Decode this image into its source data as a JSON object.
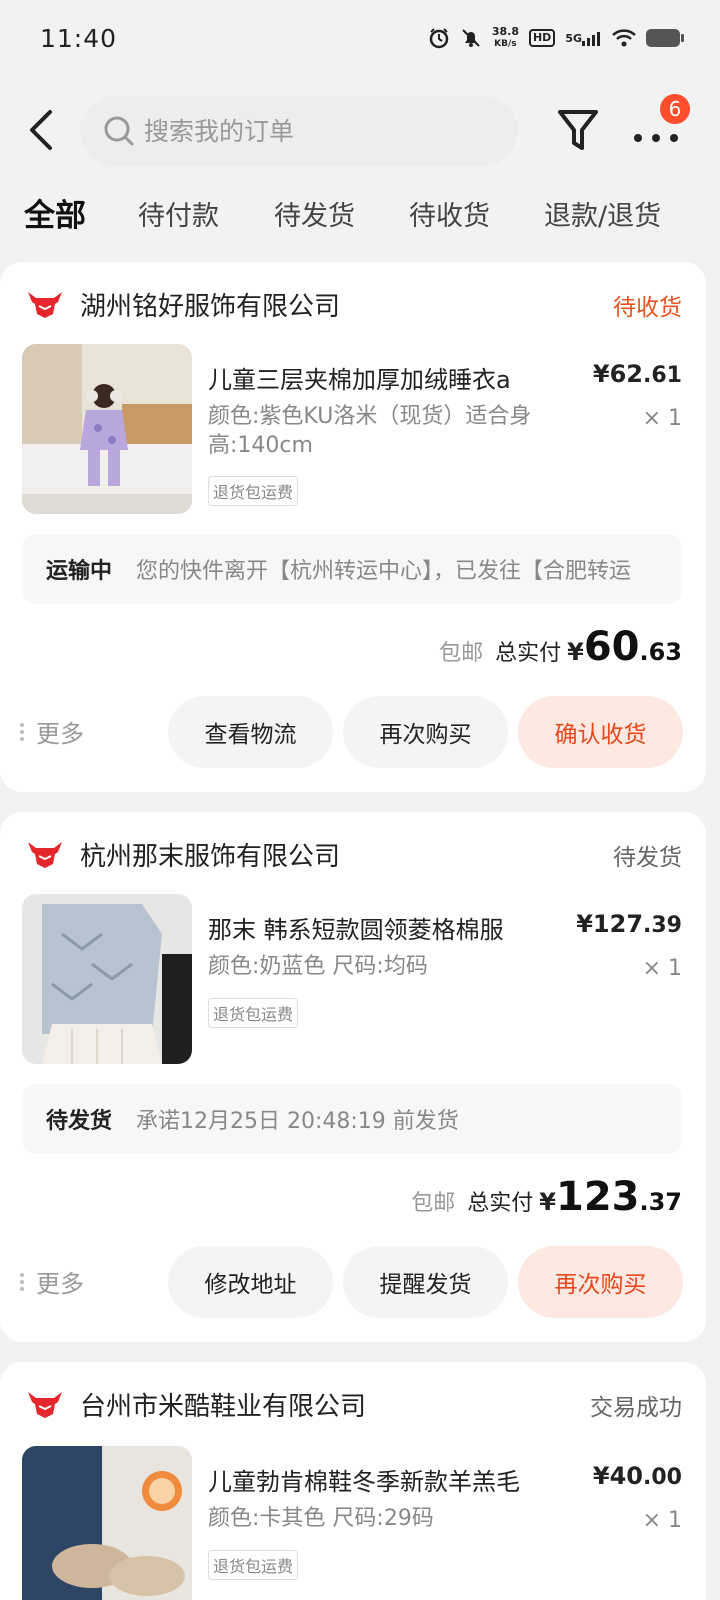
{
  "status_bar": {
    "time": "11:40",
    "net_speed_value": "38.8",
    "net_speed_unit": "KB/s",
    "hd": "HD",
    "network": "5G"
  },
  "header": {
    "search_placeholder": "搜索我的订单",
    "more_badge": "6"
  },
  "tabs": [
    "全部",
    "待付款",
    "待发货",
    "待收货",
    "退款/退货"
  ],
  "orders": [
    {
      "shop": "湖州铭好服饰有限公司",
      "status": "待收货",
      "product_title": "儿童三层夹棉加厚加绒睡衣a",
      "spec": "颜色:紫色KU洛米（现货）适合身高:140cm",
      "tag": "退货包运费",
      "price_int": "¥62",
      "price_dec": ".61",
      "qty": "× 1",
      "logistics_state": "运输中",
      "logistics_text": "您的快件离开【杭州转运中心】，已发往【合肥转运",
      "free_shipping": "包邮",
      "total_label": "总实付",
      "total_currency": "¥",
      "total_int": "60",
      "total_dec": ".63",
      "more": "更多",
      "buttons": [
        "查看物流",
        "再次购买",
        "确认收货"
      ]
    },
    {
      "shop": "杭州那末服饰有限公司",
      "status": "待发货",
      "product_title": "那末 韩系短款圆领菱格棉服",
      "spec": "颜色:奶蓝色 尺码:均码",
      "tag": "退货包运费",
      "price_int": "¥127",
      "price_dec": ".39",
      "qty": "× 1",
      "logistics_state": "待发货",
      "logistics_text": "承诺12月25日 20:48:19 前发货",
      "free_shipping": "包邮",
      "total_label": "总实付",
      "total_currency": "¥",
      "total_int": "123",
      "total_dec": ".37",
      "more": "更多",
      "buttons": [
        "修改地址",
        "提醒发货",
        "再次购买"
      ]
    },
    {
      "shop": "台州市米酷鞋业有限公司",
      "status": "交易成功",
      "product_title": "儿童勃肯棉鞋冬季新款羊羔毛",
      "spec": "颜色:卡其色 尺码:29码",
      "tag": "退货包运费",
      "price_int": "¥40",
      "price_dec": ".00",
      "qty": "× 1"
    }
  ],
  "colors": {
    "accent": "#e8541f",
    "primary_button_bg": "#fde9e2",
    "badge": "#ff4d2e",
    "shop_logo": "#e4262c"
  }
}
